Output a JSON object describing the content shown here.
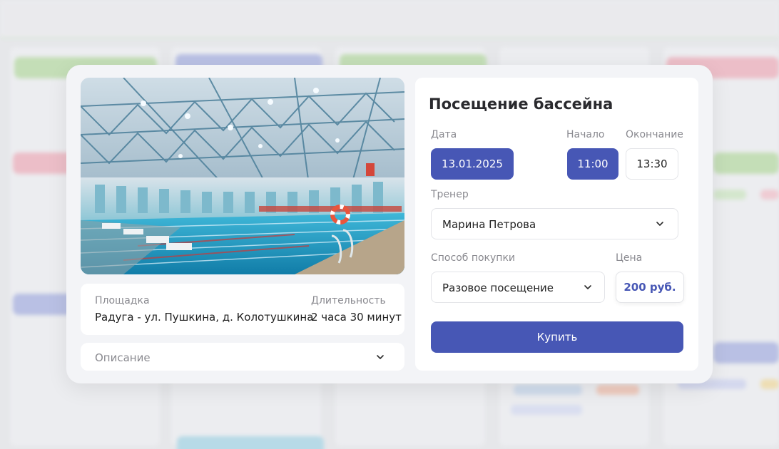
{
  "modal": {
    "title": "Посещение бассейна",
    "photo": {
      "subject": "indoor swimming pool"
    },
    "venue": {
      "label": "Площадка",
      "value": "Радуга - ул. Пушкина, д. Колотушкина"
    },
    "duration": {
      "label": "Длительность",
      "value": "2 часа 30 минут"
    },
    "description": {
      "label": "Описание",
      "icon": "chevron-down-icon"
    },
    "date": {
      "label": "Дата",
      "value": "13.01.2025"
    },
    "start": {
      "label": "Начало",
      "value": "11:00"
    },
    "end": {
      "label": "Окончание",
      "value": "13:30"
    },
    "trainer": {
      "label": "Тренер",
      "value": "Марина Петрова",
      "icon": "chevron-down-icon"
    },
    "purchase": {
      "label": "Способ покупки",
      "value": "Разовое посещение",
      "icon": "chevron-down-icon"
    },
    "price": {
      "label": "Цена",
      "value": "200 руб."
    },
    "buy_label": "Купить"
  },
  "colors": {
    "accent": "#4757b5",
    "card": "#ffffff",
    "modal_bg": "#f3f4f7",
    "muted_text": "#8a8a90"
  }
}
